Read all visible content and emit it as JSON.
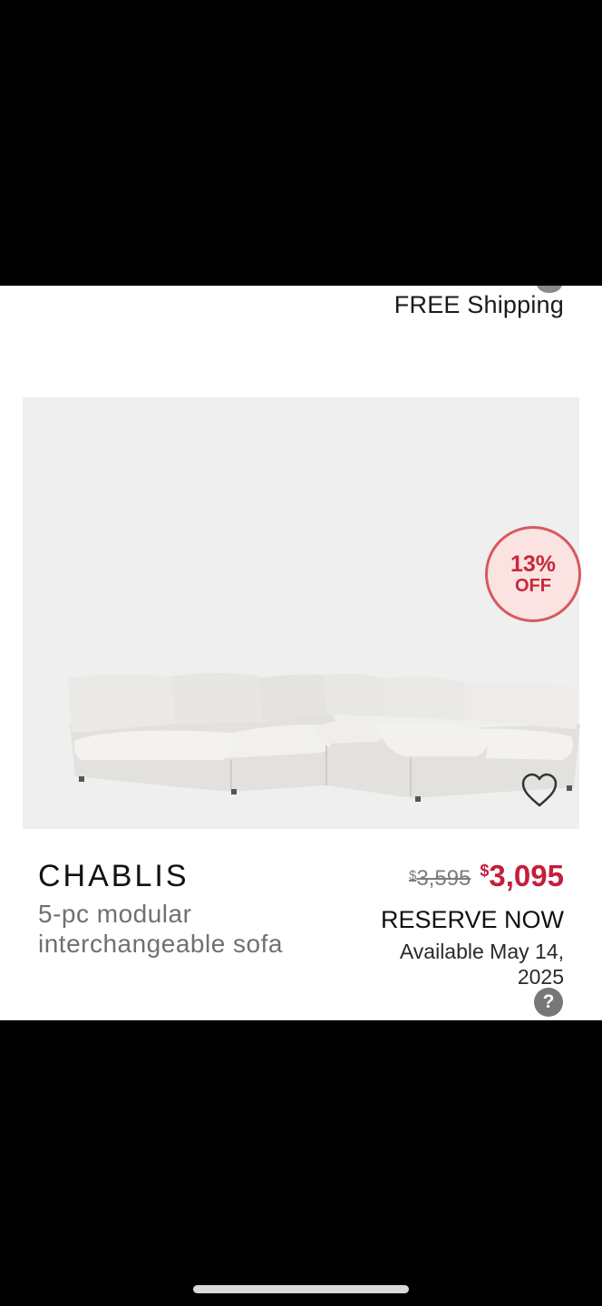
{
  "shipping": {
    "label": "FREE Shipping"
  },
  "badge": {
    "percent": "13%",
    "off_label": "OFF"
  },
  "product": {
    "name": "CHABLIS",
    "description": "5-pc modular interchangeable sofa",
    "image_alt": "sofa-image"
  },
  "pricing": {
    "currency_symbol": "$",
    "original_price": "3,595",
    "sale_price": "3,095",
    "sale_color": "#c41e3a"
  },
  "cta": {
    "label": "RESERVE NOW"
  },
  "availability": {
    "text": "Available May 14, 2025"
  },
  "help": {
    "glyph": "?",
    "icon": "question-icon"
  },
  "favorite": {
    "icon": "heart-icon"
  }
}
